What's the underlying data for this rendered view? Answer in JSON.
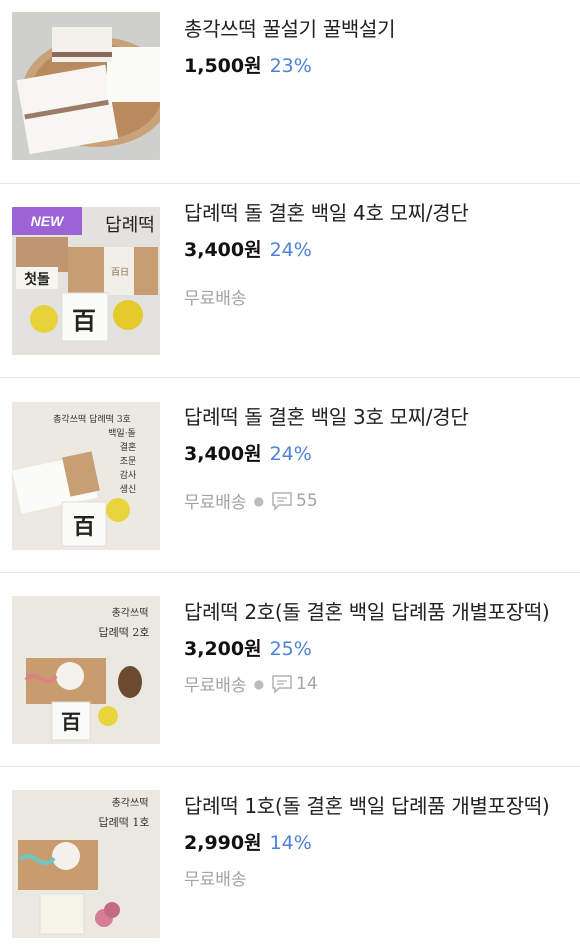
{
  "products": [
    {
      "title": "총각쓰떡 꿀설기 꿀백설기",
      "price": "1,500원",
      "discount": "23%",
      "shipping": "",
      "reviews": "",
      "badge": "",
      "image_text": []
    },
    {
      "title": "답례떡 돌 결혼 백일 4호 모찌/경단",
      "price": "3,400원",
      "discount": "24%",
      "shipping": "무료배송",
      "reviews": "",
      "badge": "NEW",
      "image_text": [
        "답례떡",
        "첫돌",
        "百",
        "百日"
      ]
    },
    {
      "title": "답례떡 돌 결혼 백일 3호 모찌/경단",
      "price": "3,400원",
      "discount": "24%",
      "shipping": "무료배송",
      "reviews": "55",
      "badge": "",
      "image_text": [
        "총각쓰떡 답례떡 3호",
        "백일·돌",
        "결혼",
        "조문",
        "감사",
        "생신",
        "百"
      ]
    },
    {
      "title": "답례떡 2호(돌 결혼 백일 답례품 개별포장떡)",
      "price": "3,200원",
      "discount": "25%",
      "shipping": "무료배송",
      "reviews": "14",
      "badge": "",
      "image_text": [
        "총각쓰떡",
        "답례떡 2호",
        "百"
      ]
    },
    {
      "title": "답례떡 1호(돌 결혼 백일 답례품 개별포장떡)",
      "price": "2,990원",
      "discount": "14%",
      "shipping": "무료배송",
      "reviews": "",
      "badge": "",
      "image_text": [
        "총각쓰떡",
        "답례떡 1호"
      ]
    }
  ],
  "icons": {
    "review": "speech-bubble-icon"
  },
  "colors": {
    "discount": "#4d82d6",
    "badge": "#9b63d6",
    "meta": "#a3a3a3"
  }
}
